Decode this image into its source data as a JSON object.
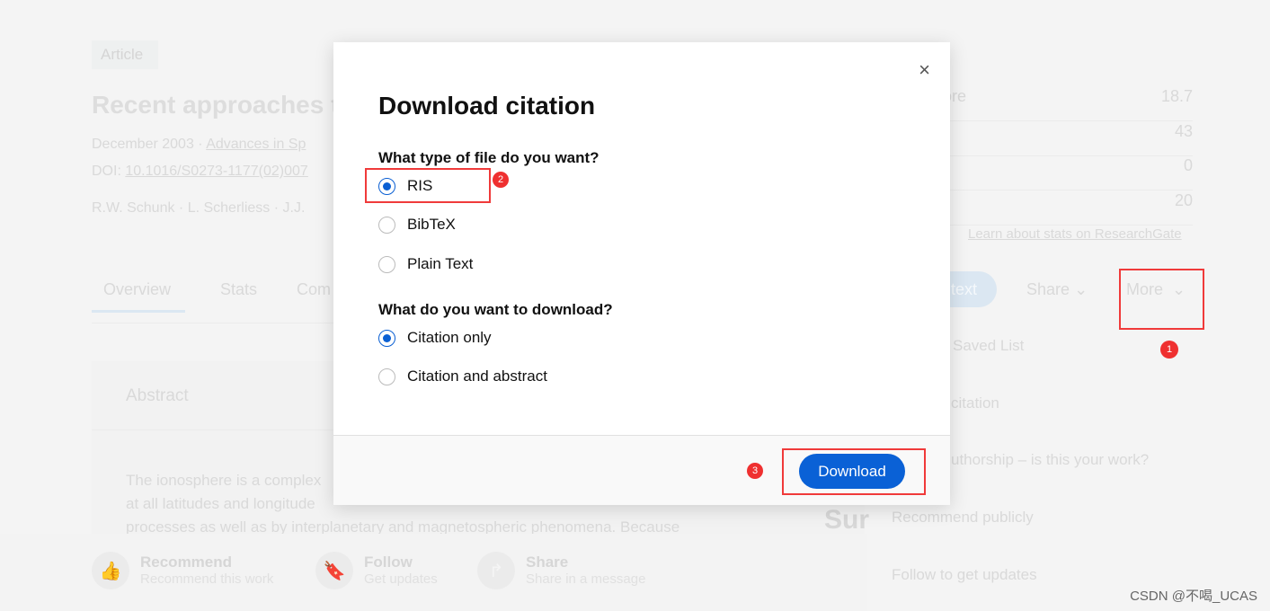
{
  "background": {
    "badge": "Article",
    "title": "Recent approaches t",
    "meta_date": "December 2003 · ",
    "meta_journal": "Advances in Sp",
    "doi_label": "DOI: ",
    "doi": "10.1016/S0273-1177(02)007",
    "authors": "R.W. Schunk · L. Scherliess · J.J.",
    "tabs": [
      {
        "label": "Overview"
      },
      {
        "label": "Stats"
      },
      {
        "label": "Com"
      }
    ],
    "abstract_heading": "Abstract",
    "abstract_lines": [
      "The ionosphere is a complex",
      "at all latitudes and longitude",
      "processes as well as by interplanetary and magnetospheric phenomena. Because"
    ],
    "sur": "Sur",
    "stats": [
      {
        "label": "core",
        "value": "18.7"
      },
      {
        "label": "",
        "value": "43"
      },
      {
        "label": "",
        "value": "0"
      },
      {
        "label": "",
        "value": "20"
      }
    ],
    "stats_link": "Learn about stats on ResearchGate",
    "fulltext_btn": "text",
    "share_btn": "Share",
    "more_btn": "More",
    "menu": [
      "Saved List",
      "citation",
      "uthorship – is this your work?",
      "Recommend publicly",
      "Follow to get updates"
    ],
    "actions": [
      {
        "title": "Recommend",
        "sub": "Recommend this work",
        "icon": "thumbs-up-icon"
      },
      {
        "title": "Follow",
        "sub": "Get updates",
        "icon": "bookmark-icon"
      },
      {
        "title": "Share",
        "sub": "Share in a message",
        "icon": "share-arrow-icon"
      }
    ]
  },
  "modal": {
    "title": "Download citation",
    "q1": "What type of file do you want?",
    "file_types": [
      {
        "label": "RIS",
        "selected": true
      },
      {
        "label": "BibTeX",
        "selected": false
      },
      {
        "label": "Plain Text",
        "selected": false
      }
    ],
    "q2": "What do you want to download?",
    "content_types": [
      {
        "label": "Citation only",
        "selected": true
      },
      {
        "label": "Citation and abstract",
        "selected": false
      }
    ],
    "download_label": "Download",
    "close": "×"
  },
  "annotations": [
    "1",
    "2",
    "3"
  ],
  "watermark": "CSDN @不喝_UCAS",
  "colors": {
    "accent": "#0a61d6",
    "annotation": "#ef3030"
  }
}
